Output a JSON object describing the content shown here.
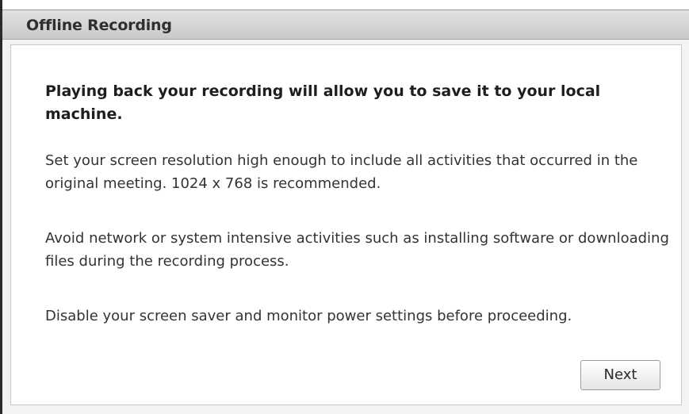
{
  "dialog": {
    "title": "Offline Recording",
    "headline": "Playing back your recording will allow you to save it to your local machine.",
    "paragraphs": [
      "Set your screen resolution high enough to include all activities that occurred in the original meeting. 1024 x 768 is recommended.",
      "Avoid network or system intensive activities such as installing software or downloading files during the recording process.",
      "Disable your screen saver and monitor power settings before proceeding."
    ],
    "next_label": "Next"
  }
}
